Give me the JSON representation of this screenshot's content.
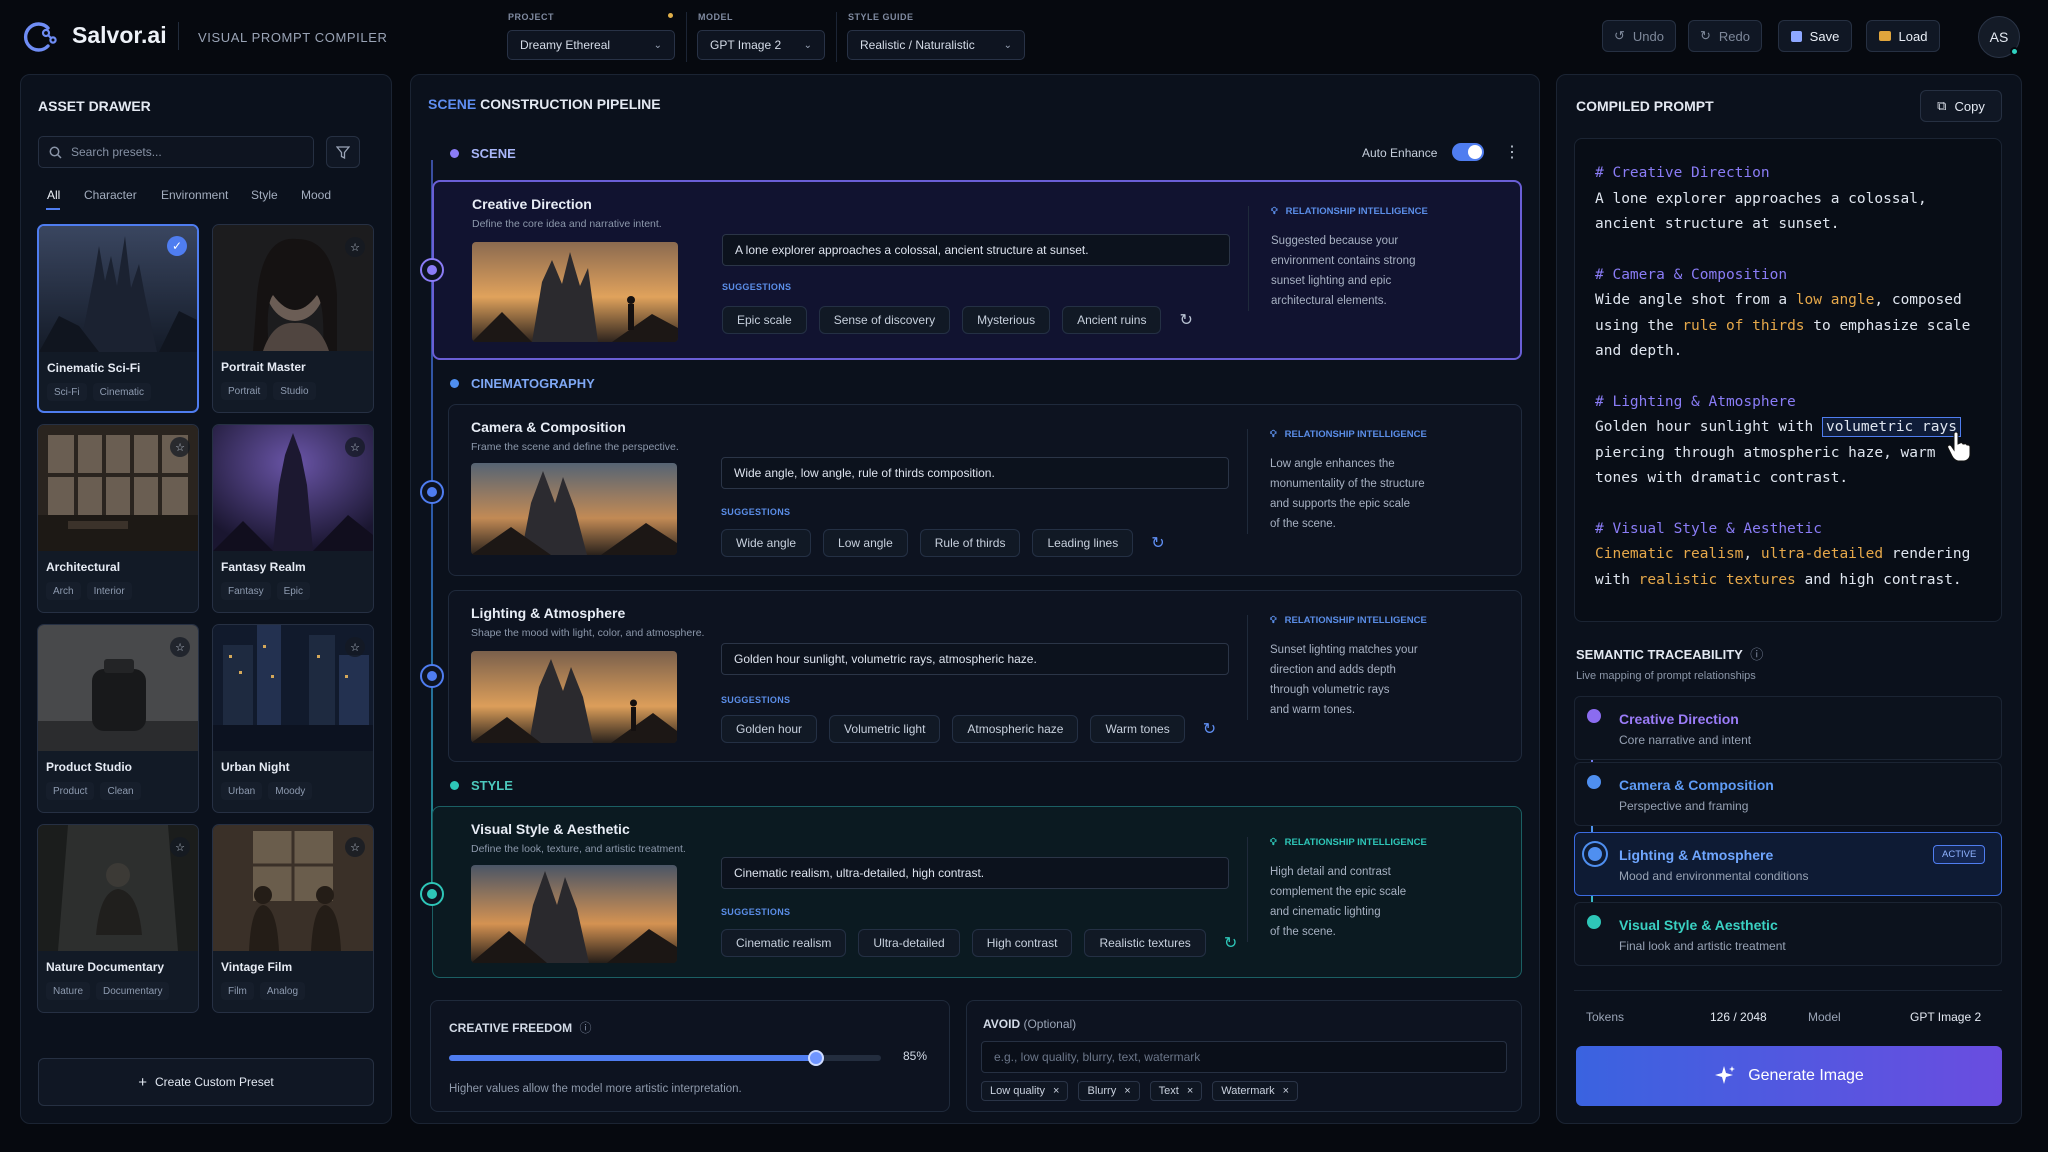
{
  "app": {
    "name": "Salvor.ai",
    "subtitle": "VISUAL PROMPT COMPILER"
  },
  "header": {
    "project": {
      "label": "PROJECT",
      "value": "Dreamy Ethereal"
    },
    "model": {
      "label": "MODEL",
      "value": "GPT Image 2"
    },
    "style_guide": {
      "label": "STYLE GUIDE",
      "value": "Realistic / Naturalistic"
    },
    "undo": "Undo",
    "redo": "Redo",
    "save": "Save",
    "load": "Load",
    "avatar": "AS"
  },
  "asset_drawer": {
    "title": "ASSET DRAWER",
    "search_placeholder": "Search presets...",
    "tabs": [
      "All",
      "Character",
      "Environment",
      "Style",
      "Mood"
    ],
    "cards": [
      {
        "title": "Cinematic Sci-Fi",
        "tags": [
          "Sci-Fi",
          "Cinematic"
        ],
        "selected": true
      },
      {
        "title": "Portrait Master",
        "tags": [
          "Portrait",
          "Studio"
        ]
      },
      {
        "title": "Architectural",
        "tags": [
          "Arch",
          "Interior"
        ]
      },
      {
        "title": "Fantasy Realm",
        "tags": [
          "Fantasy",
          "Epic"
        ]
      },
      {
        "title": "Product Studio",
        "tags": [
          "Product",
          "Clean"
        ]
      },
      {
        "title": "Urban Night",
        "tags": [
          "Urban",
          "Moody"
        ]
      },
      {
        "title": "Nature Documentary",
        "tags": [
          "Nature",
          "Documentary"
        ]
      },
      {
        "title": "Vintage Film",
        "tags": [
          "Film",
          "Analog"
        ]
      }
    ],
    "create": "Create Custom Preset"
  },
  "pipeline": {
    "title_a": "SCENE",
    "title_b": "CONSTRUCTION PIPELINE",
    "auto_enhance": "Auto Enhance",
    "section_labels": {
      "scene": "SCENE",
      "cinematography": "CINEMATOGRAPHY",
      "style": "STYLE"
    },
    "suggestions_label": "SUGGESTIONS",
    "ri_label": "RELATIONSHIP INTELLIGENCE",
    "steps": [
      {
        "title": "Creative Direction",
        "sub": "Define the core idea and narrative intent.",
        "input": "A lone explorer approaches a colossal, ancient structure at sunset.",
        "chips": [
          "Epic scale",
          "Sense of discovery",
          "Mysterious",
          "Ancient ruins"
        ],
        "ri": [
          "Suggested because your",
          "environment contains strong",
          "sunset lighting and epic",
          "architectural elements."
        ]
      },
      {
        "title": "Camera & Composition",
        "sub": "Frame the scene and define the perspective.",
        "input": "Wide angle, low angle, rule of thirds composition.",
        "chips": [
          "Wide angle",
          "Low angle",
          "Rule of thirds",
          "Leading lines"
        ],
        "ri": [
          "Low angle enhances the",
          "monumentality of the structure",
          "and supports the epic scale",
          "of the scene."
        ]
      },
      {
        "title": "Lighting & Atmosphere",
        "sub": "Shape the mood with light, color, and atmosphere.",
        "input": "Golden hour sunlight, volumetric rays, atmospheric haze.",
        "chips": [
          "Golden hour",
          "Volumetric light",
          "Atmospheric haze",
          "Warm tones"
        ],
        "ri": [
          "Sunset lighting matches your",
          "direction and adds depth",
          "through volumetric rays",
          "and warm tones."
        ]
      },
      {
        "title": "Visual Style & Aesthetic",
        "sub": "Define the look, texture, and artistic treatment.",
        "input": "Cinematic realism, ultra-detailed, high contrast.",
        "chips": [
          "Cinematic realism",
          "Ultra-detailed",
          "High contrast",
          "Realistic textures"
        ],
        "ri": [
          "High detail and contrast",
          "complement the epic scale",
          "and cinematic lighting",
          "of the scene."
        ]
      }
    ],
    "freedom": {
      "label": "CREATIVE FREEDOM",
      "value": 0.85,
      "value_label": "85%",
      "hint": "Higher values allow the model more artistic interpretation."
    },
    "avoid": {
      "label": "AVOID",
      "optional": "(Optional)",
      "placeholder": "e.g., low quality, blurry, text, watermark",
      "chips": [
        "Low quality",
        "Blurry",
        "Text",
        "Watermark"
      ]
    }
  },
  "compiled": {
    "title": "COMPILED PROMPT",
    "copy": "Copy",
    "h1": "# Creative Direction",
    "l1a": "A lone explorer approaches a colossal,",
    "l1b": "ancient structure at sunset.",
    "h2": "# Camera & Composition",
    "l2a_1": "Wide angle shot from a ",
    "l2a_2": "low angle",
    ", ": "",
    "l2a_3": ", composed",
    "l2b_1": "using the ",
    "l2b_2": "rule of thirds",
    "l2b_3": " to emphasize scale",
    "l2c": "and depth.",
    "h3": "# Lighting & Atmosphere",
    "l3a_1": "Golden hour sunlight with ",
    "l3a_2": "volumetric rays",
    "l3b": "piercing through atmospheric haze, warm",
    "l3c": "tones with dramatic contrast.",
    "h4": "# Visual Style & Aesthetic",
    "l4a_1": "Cinematic realism",
    "l4a_2": ", ",
    "l4a_3": "ultra-detailed",
    "l4a_4": " rendering",
    "l4b_1": "with ",
    "l4b_2": "realistic textures",
    "l4b_3": " and high contrast."
  },
  "traceability": {
    "title": "SEMANTIC TRACEABILITY",
    "sub": "Live mapping of prompt relationships",
    "items": [
      {
        "title": "Creative Direction",
        "sub": "Core narrative and intent",
        "color": "#8b6cf0"
      },
      {
        "title": "Camera & Composition",
        "sub": "Perspective and framing",
        "color": "#4f8ff0"
      },
      {
        "title": "Lighting & Atmosphere",
        "sub": "Mood and environmental conditions",
        "color": "#4f8ff0",
        "badge": "ACTIVE"
      },
      {
        "title": "Visual Style & Aesthetic",
        "sub": "Final look and artistic treatment",
        "color": "#2ec6b8"
      }
    ]
  },
  "footer": {
    "tokens_label": "Tokens",
    "tokens": "126 / 2048",
    "model_label": "Model",
    "model": "GPT Image 2",
    "generate": "Generate Image"
  }
}
